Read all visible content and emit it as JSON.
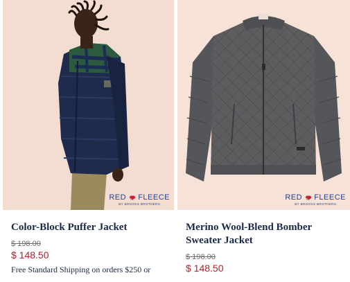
{
  "products": [
    {
      "title": "Color-Block Puffer Jacket",
      "original_price": "$ 198.00",
      "sale_price": "$ 148.50",
      "promo": "Free Standard Shipping on orders $250 or",
      "badge": {
        "main_left": "RED",
        "main_right": "FLEECE",
        "sub": "BY BROOKS BROTHERS"
      }
    },
    {
      "title": "Merino Wool-Blend Bomber Sweater Jacket",
      "original_price": "$ 198.00",
      "sale_price": "$ 148.50",
      "badge": {
        "main_left": "RED",
        "main_right": "FLEECE",
        "sub": "BY BROOKS BROTHERS"
      }
    }
  ],
  "colors": {
    "price_sale": "#b0202d",
    "brand_blue": "#2a3f8f",
    "brand_red": "#c8202f",
    "title": "#1a2847"
  }
}
